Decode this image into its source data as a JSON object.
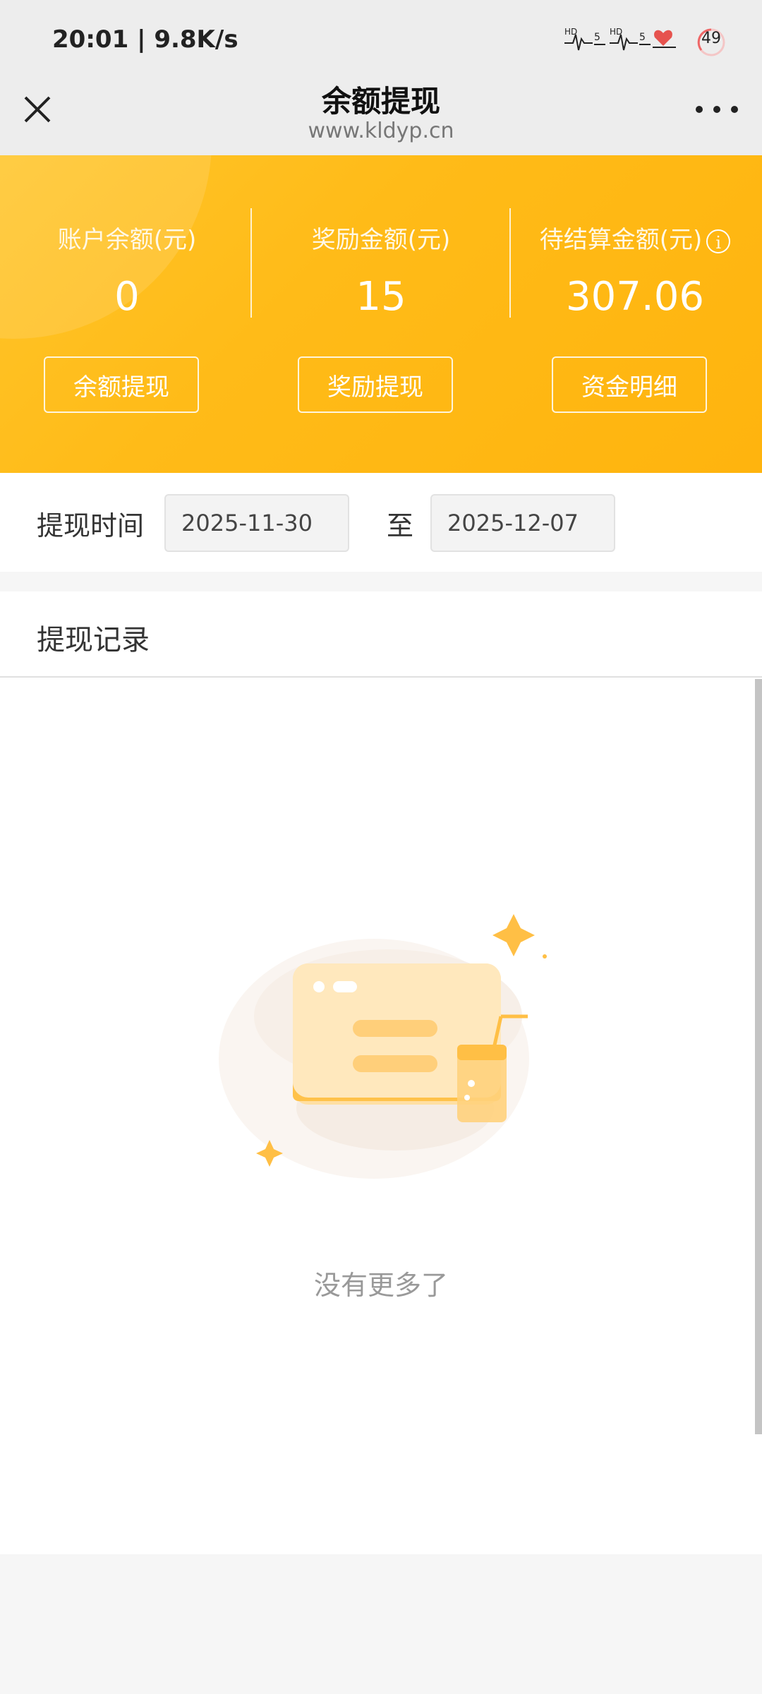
{
  "status_bar": {
    "time_speed": "20:01 | 9.8K/s",
    "signal_label_1": "HD",
    "signal_num_1": "5",
    "signal_label_2": "HD",
    "signal_num_2": "5",
    "battery": "49"
  },
  "header": {
    "title": "余额提现",
    "url": "www.kldyp.cn"
  },
  "summary": {
    "accent": "#ffbb18",
    "columns": [
      {
        "label": "账户余额(元)",
        "value": "0",
        "button": "余额提现"
      },
      {
        "label": "奖励金额(元)",
        "value": "15",
        "button": "奖励提现"
      },
      {
        "label": "待结算金额(元)",
        "value": "307.06",
        "button": "资金明细",
        "info_icon": "i"
      }
    ]
  },
  "filter": {
    "label": "提现时间",
    "start_date": "2025-11-30",
    "separator": "至",
    "end_date": "2025-12-07"
  },
  "records": {
    "title": "提现记录",
    "empty_text": "没有更多了"
  }
}
